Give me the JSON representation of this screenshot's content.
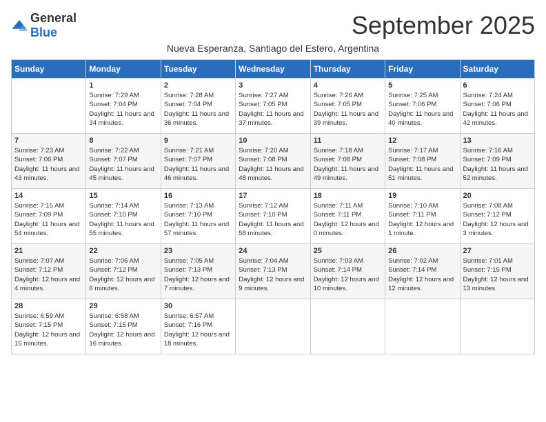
{
  "logo": {
    "general": "General",
    "blue": "Blue"
  },
  "title": "September 2025",
  "subtitle": "Nueva Esperanza, Santiago del Estero, Argentina",
  "days_of_week": [
    "Sunday",
    "Monday",
    "Tuesday",
    "Wednesday",
    "Thursday",
    "Friday",
    "Saturday"
  ],
  "weeks": [
    [
      {
        "day": "",
        "sunrise": "",
        "sunset": "",
        "daylight": ""
      },
      {
        "day": "1",
        "sunrise": "Sunrise: 7:29 AM",
        "sunset": "Sunset: 7:04 PM",
        "daylight": "Daylight: 11 hours and 34 minutes."
      },
      {
        "day": "2",
        "sunrise": "Sunrise: 7:28 AM",
        "sunset": "Sunset: 7:04 PM",
        "daylight": "Daylight: 11 hours and 36 minutes."
      },
      {
        "day": "3",
        "sunrise": "Sunrise: 7:27 AM",
        "sunset": "Sunset: 7:05 PM",
        "daylight": "Daylight: 11 hours and 37 minutes."
      },
      {
        "day": "4",
        "sunrise": "Sunrise: 7:26 AM",
        "sunset": "Sunset: 7:05 PM",
        "daylight": "Daylight: 11 hours and 39 minutes."
      },
      {
        "day": "5",
        "sunrise": "Sunrise: 7:25 AM",
        "sunset": "Sunset: 7:06 PM",
        "daylight": "Daylight: 11 hours and 40 minutes."
      },
      {
        "day": "6",
        "sunrise": "Sunrise: 7:24 AM",
        "sunset": "Sunset: 7:06 PM",
        "daylight": "Daylight: 11 hours and 42 minutes."
      }
    ],
    [
      {
        "day": "7",
        "sunrise": "Sunrise: 7:23 AM",
        "sunset": "Sunset: 7:06 PM",
        "daylight": "Daylight: 11 hours and 43 minutes."
      },
      {
        "day": "8",
        "sunrise": "Sunrise: 7:22 AM",
        "sunset": "Sunset: 7:07 PM",
        "daylight": "Daylight: 11 hours and 45 minutes."
      },
      {
        "day": "9",
        "sunrise": "Sunrise: 7:21 AM",
        "sunset": "Sunset: 7:07 PM",
        "daylight": "Daylight: 11 hours and 46 minutes."
      },
      {
        "day": "10",
        "sunrise": "Sunrise: 7:20 AM",
        "sunset": "Sunset: 7:08 PM",
        "daylight": "Daylight: 11 hours and 48 minutes."
      },
      {
        "day": "11",
        "sunrise": "Sunrise: 7:18 AM",
        "sunset": "Sunset: 7:08 PM",
        "daylight": "Daylight: 11 hours and 49 minutes."
      },
      {
        "day": "12",
        "sunrise": "Sunrise: 7:17 AM",
        "sunset": "Sunset: 7:08 PM",
        "daylight": "Daylight: 11 hours and 51 minutes."
      },
      {
        "day": "13",
        "sunrise": "Sunrise: 7:16 AM",
        "sunset": "Sunset: 7:09 PM",
        "daylight": "Daylight: 11 hours and 52 minutes."
      }
    ],
    [
      {
        "day": "14",
        "sunrise": "Sunrise: 7:15 AM",
        "sunset": "Sunset: 7:09 PM",
        "daylight": "Daylight: 11 hours and 54 minutes."
      },
      {
        "day": "15",
        "sunrise": "Sunrise: 7:14 AM",
        "sunset": "Sunset: 7:10 PM",
        "daylight": "Daylight: 11 hours and 55 minutes."
      },
      {
        "day": "16",
        "sunrise": "Sunrise: 7:13 AM",
        "sunset": "Sunset: 7:10 PM",
        "daylight": "Daylight: 11 hours and 57 minutes."
      },
      {
        "day": "17",
        "sunrise": "Sunrise: 7:12 AM",
        "sunset": "Sunset: 7:10 PM",
        "daylight": "Daylight: 11 hours and 58 minutes."
      },
      {
        "day": "18",
        "sunrise": "Sunrise: 7:11 AM",
        "sunset": "Sunset: 7:11 PM",
        "daylight": "Daylight: 12 hours and 0 minutes."
      },
      {
        "day": "19",
        "sunrise": "Sunrise: 7:10 AM",
        "sunset": "Sunset: 7:11 PM",
        "daylight": "Daylight: 12 hours and 1 minute."
      },
      {
        "day": "20",
        "sunrise": "Sunrise: 7:08 AM",
        "sunset": "Sunset: 7:12 PM",
        "daylight": "Daylight: 12 hours and 3 minutes."
      }
    ],
    [
      {
        "day": "21",
        "sunrise": "Sunrise: 7:07 AM",
        "sunset": "Sunset: 7:12 PM",
        "daylight": "Daylight: 12 hours and 4 minutes."
      },
      {
        "day": "22",
        "sunrise": "Sunrise: 7:06 AM",
        "sunset": "Sunset: 7:12 PM",
        "daylight": "Daylight: 12 hours and 6 minutes."
      },
      {
        "day": "23",
        "sunrise": "Sunrise: 7:05 AM",
        "sunset": "Sunset: 7:13 PM",
        "daylight": "Daylight: 12 hours and 7 minutes."
      },
      {
        "day": "24",
        "sunrise": "Sunrise: 7:04 AM",
        "sunset": "Sunset: 7:13 PM",
        "daylight": "Daylight: 12 hours and 9 minutes."
      },
      {
        "day": "25",
        "sunrise": "Sunrise: 7:03 AM",
        "sunset": "Sunset: 7:14 PM",
        "daylight": "Daylight: 12 hours and 10 minutes."
      },
      {
        "day": "26",
        "sunrise": "Sunrise: 7:02 AM",
        "sunset": "Sunset: 7:14 PM",
        "daylight": "Daylight: 12 hours and 12 minutes."
      },
      {
        "day": "27",
        "sunrise": "Sunrise: 7:01 AM",
        "sunset": "Sunset: 7:15 PM",
        "daylight": "Daylight: 12 hours and 13 minutes."
      }
    ],
    [
      {
        "day": "28",
        "sunrise": "Sunrise: 6:59 AM",
        "sunset": "Sunset: 7:15 PM",
        "daylight": "Daylight: 12 hours and 15 minutes."
      },
      {
        "day": "29",
        "sunrise": "Sunrise: 6:58 AM",
        "sunset": "Sunset: 7:15 PM",
        "daylight": "Daylight: 12 hours and 16 minutes."
      },
      {
        "day": "30",
        "sunrise": "Sunrise: 6:57 AM",
        "sunset": "Sunset: 7:16 PM",
        "daylight": "Daylight: 12 hours and 18 minutes."
      },
      {
        "day": "",
        "sunrise": "",
        "sunset": "",
        "daylight": ""
      },
      {
        "day": "",
        "sunrise": "",
        "sunset": "",
        "daylight": ""
      },
      {
        "day": "",
        "sunrise": "",
        "sunset": "",
        "daylight": ""
      },
      {
        "day": "",
        "sunrise": "",
        "sunset": "",
        "daylight": ""
      }
    ]
  ]
}
